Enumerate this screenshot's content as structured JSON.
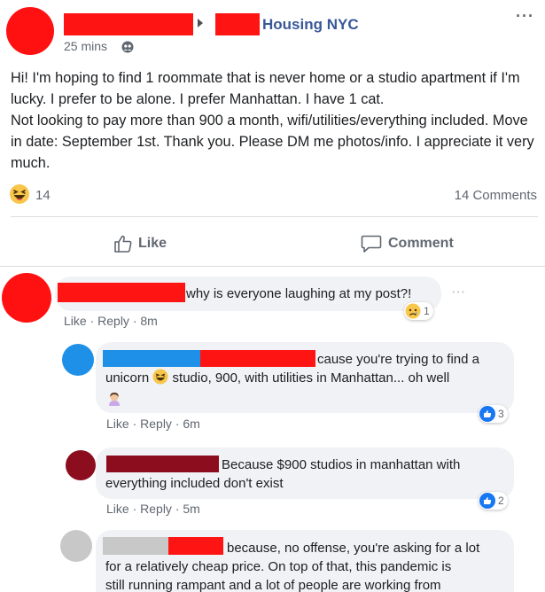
{
  "post": {
    "group_name": "Housing NYC",
    "time": "25 mins",
    "more": "···",
    "body": [
      "Hi! I'm hoping to find 1 roommate that is never home or a studio apartment if I'm lucky. I prefer to be alone. I prefer Manhattan. I have 1 cat.",
      "Not looking to pay more than 900 a month, wifi/utilities/everything included. Move in date: September 1st. Thank you. Please DM me photos/info. I appreciate it very much."
    ],
    "reaction_count": "14",
    "comment_count": "14 Comments",
    "like_label": "Like",
    "comment_label": "Comment"
  },
  "comments": [
    {
      "text": "why is everyone laughing at my post?!",
      "reaction_count": "1",
      "like": "Like",
      "reply": "Reply",
      "time": "8m",
      "more": "···"
    },
    {
      "text_a": "cause you're trying to find a",
      "text_b": "unicorn",
      "text_c": "studio, 900, with utilities in Manhattan... oh well",
      "reaction_count": "3",
      "like": "Like",
      "reply": "Reply",
      "time": "6m"
    },
    {
      "text_a": "Because $900 studios in manhattan with",
      "text_b": "everything included don't exist",
      "reaction_count": "2",
      "like": "Like",
      "reply": "Reply",
      "time": "5m"
    },
    {
      "text_a": "because, no offense, you're asking for a lot",
      "text_b": "for a relatively cheap price. On top of that, this pandemic is",
      "text_c": "still running rampant and a lot of people are working from"
    }
  ],
  "colors": {
    "link": "#385898",
    "redaction": "#ff1414",
    "like_blue": "#1877f2",
    "avatar_blue": "#1e90e8",
    "avatar_maroon": "#8b0d1e",
    "avatar_gray": "#c8c8c8"
  }
}
